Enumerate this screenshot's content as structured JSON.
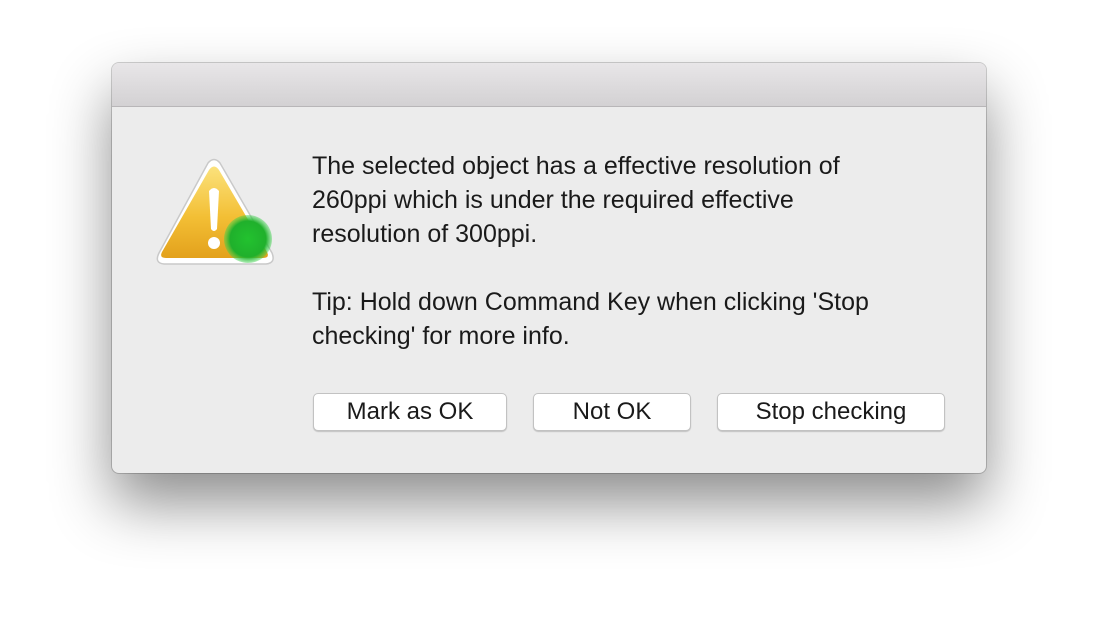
{
  "dialog": {
    "message_lines": [
      "The selected object has a effective resolution of",
      "260ppi which is under the required effective",
      "resolution of 300ppi."
    ],
    "tip_lines": [
      "Tip: Hold down Command Key when clicking 'Stop",
      "checking' for more info."
    ],
    "icon": "warning-triangle-icon",
    "badge_icon": "green-status-dot-icon",
    "buttons": {
      "mark_ok": "Mark as OK",
      "not_ok": "Not OK",
      "stop": "Stop checking"
    }
  },
  "colors": {
    "warning": "#f2b227",
    "badge": "#1fae2c",
    "dialog_bg": "#ececec"
  }
}
